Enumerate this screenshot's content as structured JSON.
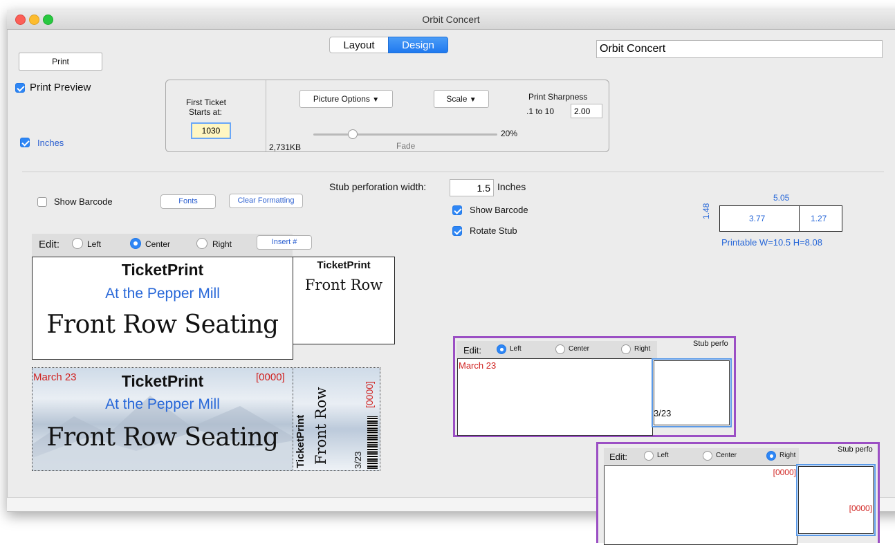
{
  "window": {
    "title": "Orbit Concert"
  },
  "tabs": [
    {
      "label": "Layout",
      "selected": false
    },
    {
      "label": "Design",
      "selected": true
    }
  ],
  "job_name_field": {
    "value": "Orbit Concert"
  },
  "print_button": "Print",
  "print_preview": {
    "label": "Print Preview",
    "checked": true
  },
  "inches": {
    "label": "Inches",
    "checked": true
  },
  "ticket_options": {
    "first_ticket_label_1": "First Ticket",
    "first_ticket_label_2": "Starts at:",
    "first_ticket_value": "1030",
    "picture_options": "Picture Options",
    "scale": "Scale",
    "print_sharpness_label": "Print Sharpness",
    "sharpness_range": ".1 to 10",
    "sharpness_value": "2.00",
    "fade_percent": "20%",
    "fade_level": 0.2,
    "fade_label": "Fade",
    "file_size": "2,731KB"
  },
  "stub": {
    "perforation_label": "Stub perforation width:",
    "perforation_value": "1.5",
    "perforation_unit": "Inches",
    "show_barcode": {
      "label": "Show Barcode",
      "checked": true
    },
    "rotate_stub": {
      "label": "Rotate Stub",
      "checked": true
    }
  },
  "left_show_barcode": {
    "label": "Show Barcode",
    "checked": false
  },
  "fonts_button": "Fonts",
  "clear_formatting_button": "Clear Formatting",
  "edit_bar": {
    "label": "Edit:",
    "options": [
      {
        "label": "Left",
        "selected": false
      },
      {
        "label": "Center",
        "selected": true
      },
      {
        "label": "Right",
        "selected": false
      }
    ],
    "insert_button": "Insert #"
  },
  "dimensions": {
    "total_width": "5.05",
    "height": "1.48",
    "main_width": "3.77",
    "stub_width": "1.27",
    "printable": "Printable W=10.5 H=8.08"
  },
  "ticket_design": {
    "line1": "TicketPrint",
    "line2": "At the Pepper Mill",
    "line3": "Front Row Seating",
    "stub_line1": "TicketPrint",
    "stub_line2": "Front Row"
  },
  "ticket_preview": {
    "date": "March 23",
    "line1": "TicketPrint",
    "line2": "At the Pepper Mill",
    "line3": "Front Row Seating",
    "number": "[0000]",
    "stub_line1": "TicketPrint",
    "stub_line2": "Front Row",
    "stub_number": "[0000]",
    "stub_date": "3/23"
  },
  "popup_left": {
    "edit_label": "Edit:",
    "options": [
      {
        "label": "Left",
        "selected": true
      },
      {
        "label": "Center",
        "selected": false
      },
      {
        "label": "Right",
        "selected": false
      }
    ],
    "stub_perf": "Stub perfo",
    "main_text": "March 23",
    "stub_text": "3/23"
  },
  "popup_right": {
    "edit_label": "Edit:",
    "options": [
      {
        "label": "Left",
        "selected": false
      },
      {
        "label": "Center",
        "selected": false
      },
      {
        "label": "Right",
        "selected": true
      }
    ],
    "stub_perf": "Stub perfo",
    "main_text": "[0000]",
    "stub_text": "[0000]"
  },
  "colors": {
    "accent": "#2e86f5",
    "ticket_blue": "#2767d8",
    "ticket_red": "#d0201e",
    "popup_border": "#9b4fc4"
  }
}
